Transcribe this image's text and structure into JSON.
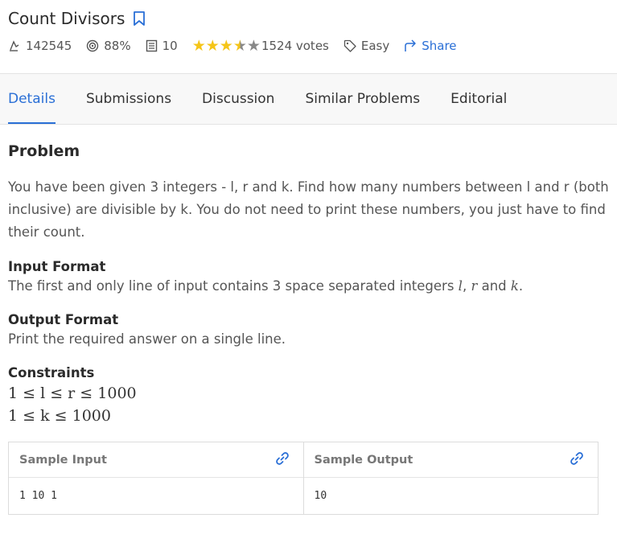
{
  "problem": {
    "title": "Count Divisors",
    "solved_count": "142545",
    "success_rate": "88%",
    "max_score": "10",
    "rating": 3.5,
    "votes": "1524 votes",
    "difficulty": "Easy",
    "share_label": "Share"
  },
  "tabs": [
    {
      "label": "Details",
      "active": true
    },
    {
      "label": "Submissions",
      "active": false
    },
    {
      "label": "Discussion",
      "active": false
    },
    {
      "label": "Similar Problems",
      "active": false
    },
    {
      "label": "Editorial",
      "active": false
    }
  ],
  "content": {
    "heading": "Problem",
    "statement": "You have been given 3 integers - l, r and k. Find how many numbers between l and r (both inclusive) are divisible by k. You do not need to print these numbers, you just have to find their count.",
    "input_heading": "Input Format",
    "input_text_pre": "The first and only line of input contains 3 space separated integers ",
    "input_var1": "l",
    "input_sep1": ", ",
    "input_var2": "r",
    "input_and": " and ",
    "input_var3": "k",
    "input_end": ".",
    "output_heading": "Output Format",
    "output_text": "Print the required answer on a single line.",
    "constraints_heading": "Constraints",
    "constraint1": {
      "a": "1",
      "op1": " ≤ ",
      "v1": "l",
      "op2": " ≤ ",
      "v2": "r",
      "op3": " ≤ ",
      "b": "1000"
    },
    "constraint2": {
      "a": "1",
      "op1": " ≤ ",
      "v1": "k",
      "op2": " ≤ ",
      "b": "1000"
    }
  },
  "samples": {
    "input_label": "Sample Input",
    "output_label": "Sample Output",
    "input_value": "1 10 1",
    "output_value": "10"
  },
  "colors": {
    "accent": "#2a6fd6",
    "star": "#f5c518"
  }
}
